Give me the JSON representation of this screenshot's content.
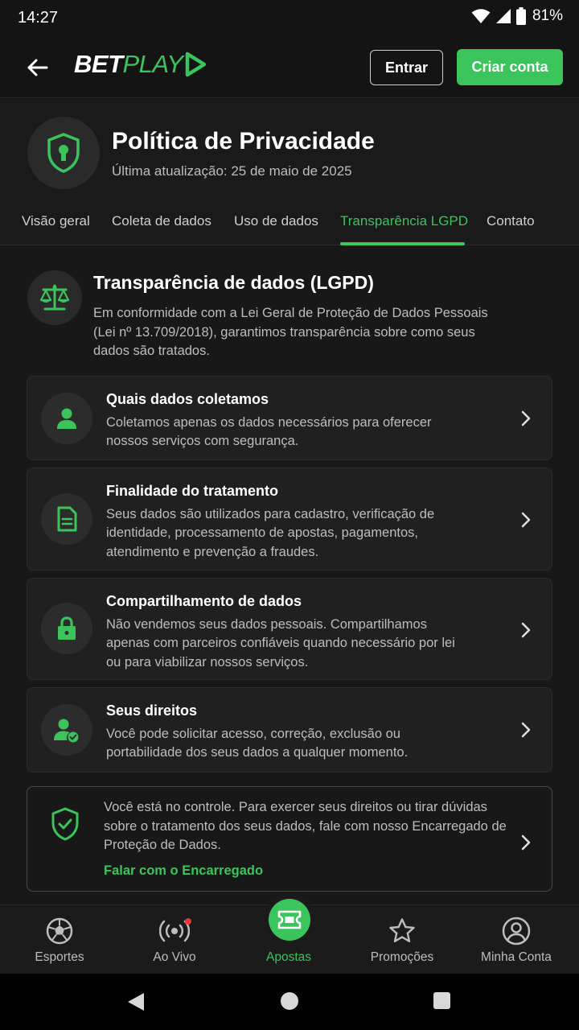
{
  "status_bar": {
    "time": "14:27",
    "battery": "81%"
  },
  "header": {
    "logo_bet": "BET",
    "logo_play": "PLAY",
    "login_label": "Entrar",
    "signup_label": "Criar conta"
  },
  "page": {
    "title": "Política de Privacidade",
    "updated": "Última atualização: 25 de maio de 2025"
  },
  "tabs": [
    {
      "label": "Visão geral"
    },
    {
      "label": "Coleta de dados"
    },
    {
      "label": "Uso de dados"
    },
    {
      "label": "Transparência LGPD",
      "active": true
    },
    {
      "label": "Contato"
    }
  ],
  "section": {
    "title": "Transparência de dados (LGPD)",
    "description": "Em conformidade com a Lei Geral de Proteção de Dados Pessoais (Lei nº 13.709/2018), garantimos transparência sobre como seus dados são tratados."
  },
  "cards": [
    {
      "title": "Quais dados coletamos",
      "text": "Coletamos apenas os dados necessários para oferecer nossos serviços com segurança.",
      "icon": "user-icon"
    },
    {
      "title": "Finalidade do tratamento",
      "text": "Seus dados são utilizados para cadastro, verificação de identidade, processamento de apostas, pagamentos, atendimento e prevenção a fraudes.",
      "icon": "document-icon"
    },
    {
      "title": "Compartilhamento de dados",
      "text": "Não vendemos seus dados pessoais. Compartilhamos apenas com parceiros confiáveis quando necessário por lei ou para viabilizar nossos serviços.",
      "icon": "lock-icon"
    },
    {
      "title": "Seus direitos",
      "text": "Você pode solicitar acesso, correção, exclusão ou portabilidade dos seus dados a qualquer momento.",
      "icon": "user-check-icon"
    }
  ],
  "control": {
    "text": "Você está no controle. Para exercer seus direitos ou tirar dúvidas sobre o tratamento dos seus dados, fale com nosso Encarregado de Proteção de Dados.",
    "link": "Falar com o Encarregado"
  },
  "bottom_nav": [
    {
      "label": "Esportes",
      "icon": "soccer-ball-icon"
    },
    {
      "label": "Ao Vivo",
      "icon": "live-broadcast-icon"
    },
    {
      "label": "Apostas",
      "icon": "ticket-icon",
      "active": true
    },
    {
      "label": "Promoções",
      "icon": "star-icon"
    },
    {
      "label": "Minha Conta",
      "icon": "account-icon"
    }
  ],
  "colors": {
    "accent": "#3cc45c",
    "background": "#141414",
    "live_dot": "#e53935"
  }
}
